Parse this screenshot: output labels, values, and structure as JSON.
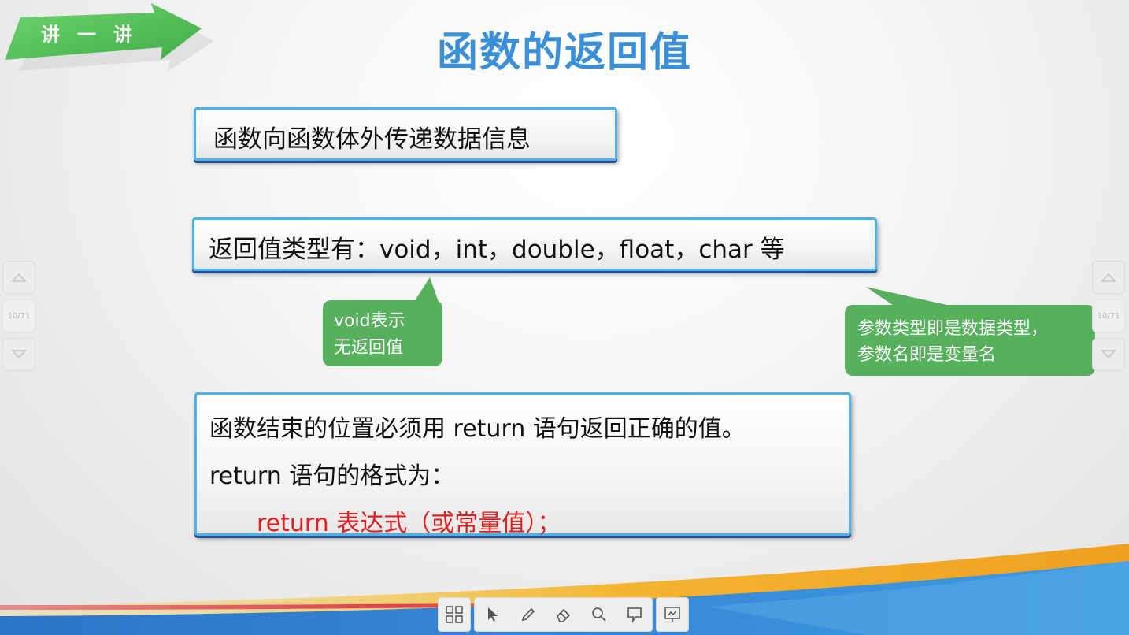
{
  "slide": {
    "badge": "讲一讲",
    "title": "函数的返回值",
    "box1": "函数向函数体外传递数据信息",
    "box2": "返回值类型有：void，int，double，float，char 等",
    "callout_void": {
      "line1": "void表示",
      "line2": "无返回值"
    },
    "callout_param": {
      "line1": "参数类型即是数据类型，",
      "line2": "参数名即是变量名"
    },
    "box3": {
      "line1": "函数结束的位置必须用 return 语句返回正确的值。",
      "line2": "return 语句的格式为：",
      "line3": "return 表达式（或常量值）；"
    }
  },
  "nav": {
    "left": {
      "page": "10/71"
    },
    "right": {
      "page": "10/71"
    }
  },
  "toolbar": {
    "buttons": [
      "grid-icon",
      "pointer-icon",
      "pen-icon",
      "eraser-icon",
      "zoom-icon",
      "comment-icon",
      "presentation-icon"
    ]
  },
  "colors": {
    "title": "#3a8fd8",
    "badge": "#5cc55c",
    "box_border": "#4bb2ea",
    "callout": "#56b05c",
    "code": "#e02020"
  }
}
